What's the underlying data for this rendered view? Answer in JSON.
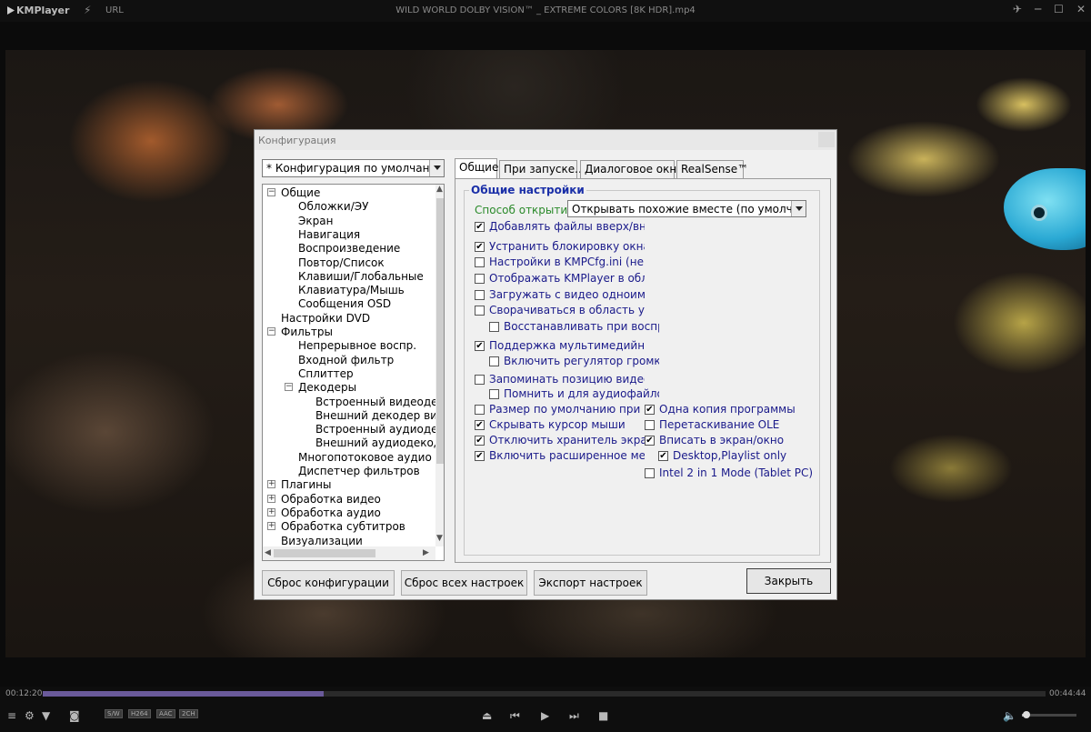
{
  "app": {
    "name": "KMPlayer",
    "url_label": "URL",
    "window_title": "WILD WORLD DOLBY VISION™ _ EXTREME COLORS [8K HDR].mp4"
  },
  "dialog": {
    "title": "Конфигурация",
    "preset": "* Конфигурация по умолчанию",
    "tabs": [
      "Общие",
      "При запуске...",
      "Диалоговое окно",
      "RealSense™"
    ],
    "active_tab": "Общие",
    "group_title": "Общие настройки",
    "open_method_label": "Способ открытия:",
    "open_method_value": "Открывать похожие вместе (по умолч.)",
    "tree": [
      {
        "label": "Общие",
        "level": 0,
        "toggle": "minus"
      },
      {
        "label": "Обложки/ЭУ",
        "level": 1
      },
      {
        "label": "Экран",
        "level": 1
      },
      {
        "label": "Навигация",
        "level": 1
      },
      {
        "label": "Воспроизведение",
        "level": 1
      },
      {
        "label": "Повтор/Список",
        "level": 1
      },
      {
        "label": "Клавиши/Глобальные",
        "level": 1
      },
      {
        "label": "Клавиатура/Мышь",
        "level": 1
      },
      {
        "label": "Сообщения OSD",
        "level": 1
      },
      {
        "label": "Настройки DVD",
        "level": 0
      },
      {
        "label": "Фильтры",
        "level": 0,
        "toggle": "minus"
      },
      {
        "label": "Непрерывное воспр.",
        "level": 1
      },
      {
        "label": "Входной фильтр",
        "level": 1
      },
      {
        "label": "Сплиттер",
        "level": 1
      },
      {
        "label": "Декодеры",
        "level": 1,
        "toggle": "minus"
      },
      {
        "label": "Встроенный видеодекодер",
        "level": 2
      },
      {
        "label": "Внешний декодер видео",
        "level": 2
      },
      {
        "label": "Встроенный аудиодекодер",
        "level": 2
      },
      {
        "label": "Внешний аудиодекодер",
        "level": 2
      },
      {
        "label": "Многопотоковое аудио",
        "level": 1
      },
      {
        "label": "Диспетчер фильтров",
        "level": 1
      },
      {
        "label": "Плагины",
        "level": 0,
        "toggle": "plus"
      },
      {
        "label": "Обработка видео",
        "level": 0,
        "toggle": "plus"
      },
      {
        "label": "Обработка аудио",
        "level": 0,
        "toggle": "plus"
      },
      {
        "label": "Обработка субтитров",
        "level": 0,
        "toggle": "plus"
      },
      {
        "label": "Визуализации",
        "level": 0
      }
    ],
    "checkboxes": [
      {
        "label": "Добавлять файлы вверх/вниз списка",
        "checked": true,
        "col": 0,
        "indent": 0
      },
      {
        "label": "Устранить блокировку окна при открытии файлов",
        "checked": true,
        "col": 0,
        "indent": 0
      },
      {
        "label": "Настройки в KMPCfg.ini (немного медленнее)",
        "checked": false,
        "col": 0,
        "indent": 0
      },
      {
        "label": "Отображать KMPlayer в области уведомлений",
        "checked": false,
        "col": 0,
        "indent": 0
      },
      {
        "label": "Загружать с видео одноименный файл субтитров",
        "checked": false,
        "col": 0,
        "indent": 0
      },
      {
        "label": "Сворачиваться в область уведомлений",
        "checked": false,
        "col": 0,
        "indent": 0
      },
      {
        "label": "Восстанавливать при воспроизведении видео",
        "checked": false,
        "col": 0,
        "indent": 1
      },
      {
        "label": "Поддержка мультимедийных клавиатур",
        "checked": true,
        "col": 0,
        "indent": 0
      },
      {
        "label": "Включить регулятор громкости",
        "checked": false,
        "col": 0,
        "indent": 1
      },
      {
        "label": "Запоминать позицию видео",
        "checked": false,
        "col": 0,
        "indent": 0
      },
      {
        "label": "Помнить и для аудиофайлов",
        "checked": false,
        "col": 0,
        "indent": 1
      },
      {
        "label": "Размер по умолчанию при запуске",
        "checked": false,
        "col": 0,
        "indent": 0
      },
      {
        "label": "Скрывать курсор мыши",
        "checked": true,
        "col": 0,
        "indent": 0
      },
      {
        "label": "Отключить хранитель экрана",
        "checked": true,
        "col": 0,
        "indent": 0
      },
      {
        "label": "Включить расширенное меню",
        "checked": true,
        "col": 0,
        "indent": 0
      },
      {
        "label": "Одна копия программы",
        "checked": true,
        "col": 1,
        "indent": 0
      },
      {
        "label": "Перетаскивание OLE",
        "checked": false,
        "col": 1,
        "indent": 0
      },
      {
        "label": "Вписать в экран/окно",
        "checked": true,
        "col": 1,
        "indent": 0
      },
      {
        "label": "Desktop,Playlist only",
        "checked": true,
        "col": 1,
        "indent": 1
      },
      {
        "label": "Intel 2 in 1 Mode (Tablet PC)",
        "checked": false,
        "col": 1,
        "indent": 0
      }
    ],
    "buttons": {
      "reset_config": "Сброс конфигурации",
      "reset_all": "Сброс всех настроек",
      "export": "Экспорт настроек",
      "close": "Закрыть"
    }
  },
  "player": {
    "current_time": "00:12:20",
    "total_time": "00:44:44",
    "progress": 0.28,
    "volume": 0.08,
    "badges": [
      "S/W",
      "H264",
      "AAC",
      "2CH"
    ]
  },
  "colors": {
    "accent_progress": "#6a5a9a",
    "group_title": "#1a2fa8",
    "option_label": "#2a8a2a",
    "checkbox_text": "#1a1a8a"
  }
}
